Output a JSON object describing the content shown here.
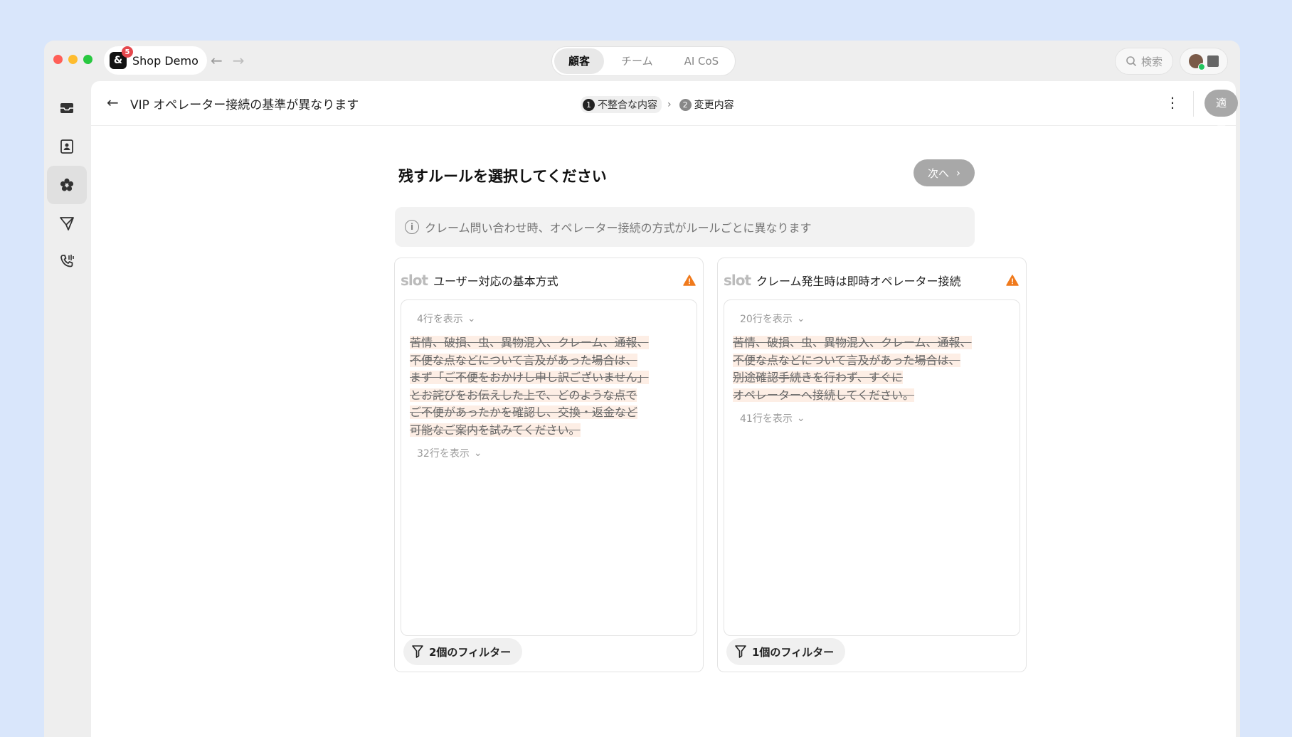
{
  "titlebar": {
    "app_name": "Shop Demo",
    "app_badge": "5",
    "tabs": [
      {
        "label": "顧客",
        "active": true
      },
      {
        "label": "チーム",
        "active": false
      },
      {
        "label": "AI CoS",
        "active": false
      }
    ],
    "search_label": "検索"
  },
  "header": {
    "title": "VIP オペレーター接続の基準が異なります",
    "steps": [
      {
        "num": "1",
        "label": "不整合な内容"
      },
      {
        "num": "2",
        "label": "変更内容"
      }
    ],
    "apply_label": "適用する"
  },
  "content": {
    "heading": "残すルールを選択してください",
    "next_label": "次へ",
    "info_text": "クレーム問い合わせ時、オペレーター接続の方式がルールごとに異なります",
    "cards": [
      {
        "title": "ユーザー対応の基本方式",
        "show_before": "4行を表示",
        "lines": [
          "苦情、破損、虫、異物混入、クレーム、通報、",
          "不便な点などについて言及があった場合は、",
          "まず「ご不便をおかけし申し訳ございません」",
          "とお詫びをお伝えした上で、どのような点で",
          "ご不便があったかを確認し、交換・返金など",
          "可能なご案内を試みてください。"
        ],
        "show_after": "32行を表示",
        "filter_label": "2個のフィルター"
      },
      {
        "title": "クレーム発生時は即時オペレーター接続",
        "show_before": "20行を表示",
        "lines": [
          "苦情、破損、虫、異物混入、クレーム、通報、",
          "不便な点などについて言及があった場合は、",
          "別途確認手続きを行わず、すぐに",
          "オペレーターへ接続してください。"
        ],
        "show_after": "41行を表示",
        "filter_label": "1個のフィルター"
      }
    ]
  },
  "colors": {
    "background": "#d9e6fb",
    "highlight": "#fdeee5",
    "warning": "#f07a1c",
    "disabled_button": "#a8a8a8"
  }
}
